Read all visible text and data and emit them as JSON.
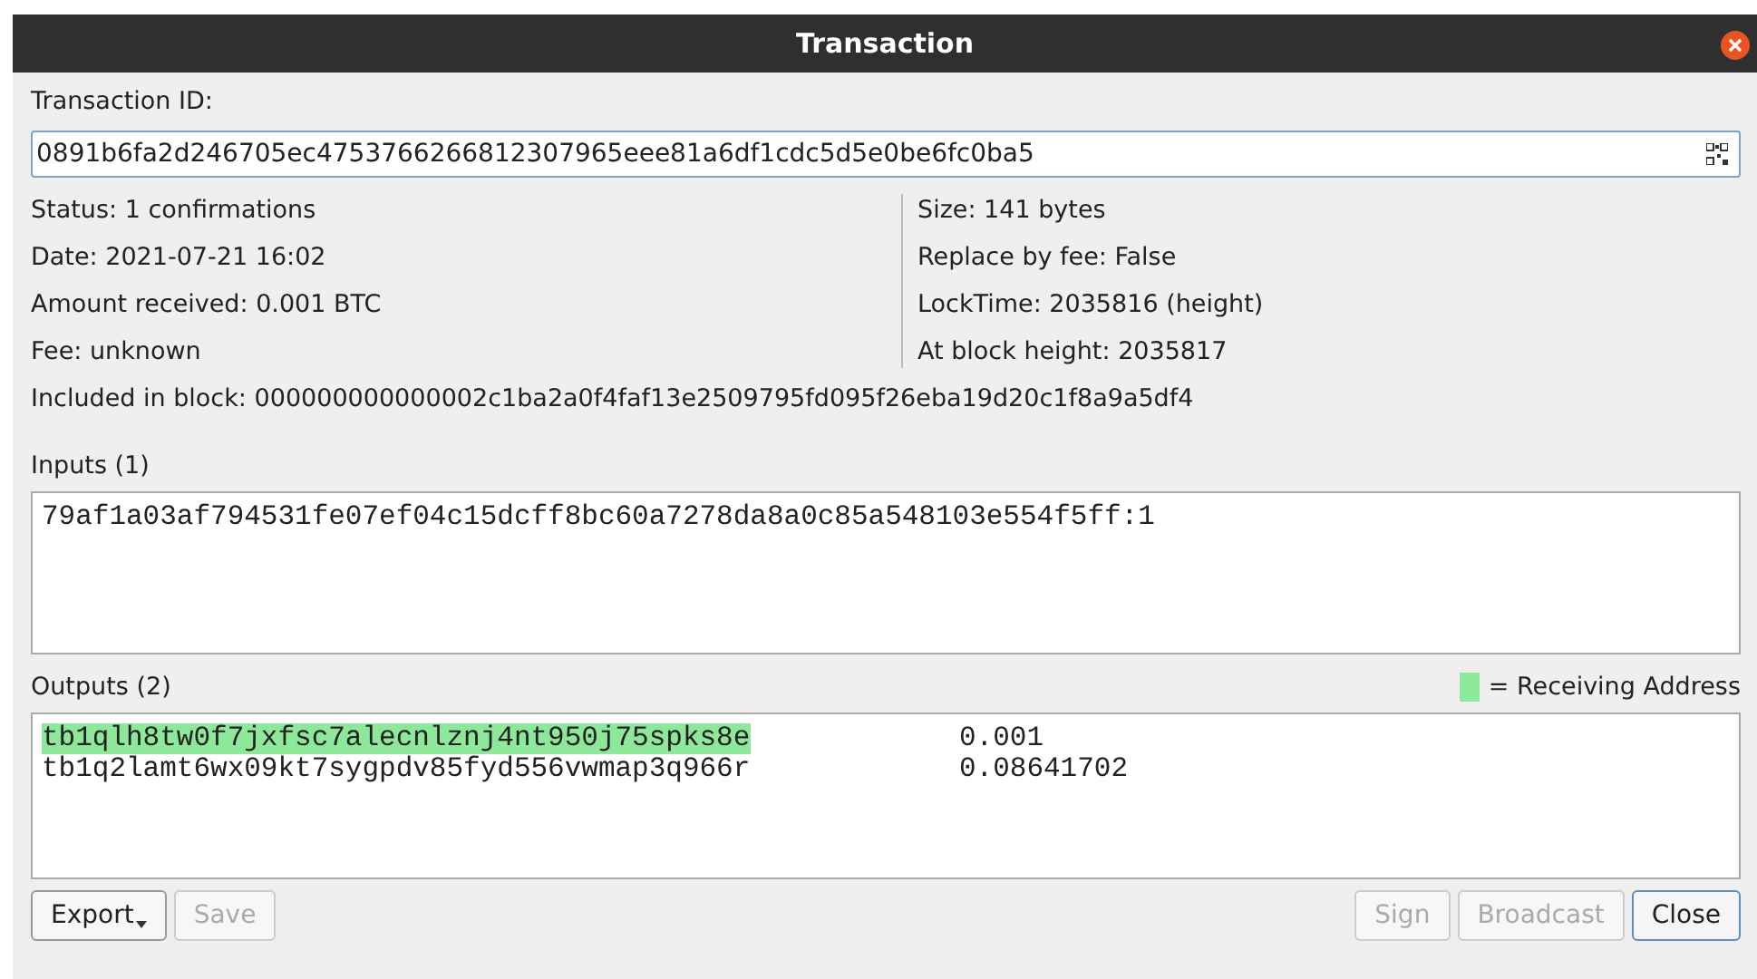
{
  "window": {
    "title": "Transaction"
  },
  "transaction_id": {
    "label": "Transaction ID:",
    "value": "0891b6fa2d246705ec4753766266812307965eee81a6df1cdc5d5e0be6fc0ba5"
  },
  "details_left": [
    "Status: 1 confirmations",
    "Date: 2021-07-21 16:02",
    "Amount received: 0.001 BTC",
    "Fee: unknown"
  ],
  "details_right": [
    "Size: 141 bytes",
    "Replace by fee: False",
    "LockTime: 2035816 (height)",
    "At block height: 2035817"
  ],
  "included_in_block": "Included in block: 000000000000002c1ba2a0f4faf13e2509795fd095f26eba19d20c1f8a9a5df4",
  "inputs": {
    "label": "Inputs (1)",
    "rows": [
      "79af1a03af794531fe07ef04c15dcff8bc60a7278da8a0c85a548103e554f5ff:1"
    ]
  },
  "outputs": {
    "label": "Outputs (2)",
    "legend": "= Receiving Address",
    "rows": [
      {
        "address": "tb1qlh8tw0f7jxfsc7alecnlznj4nt950j75spks8e",
        "amount": "0.001",
        "receiving": true
      },
      {
        "address": "tb1q2lamt6wx09kt7sygpdv85fyd556vwmap3q966r",
        "amount": "0.08641702",
        "receiving": false
      }
    ]
  },
  "buttons_left": [
    {
      "label": "Export",
      "menu": true,
      "disabled": false
    },
    {
      "label": "Save",
      "menu": false,
      "disabled": true
    }
  ],
  "buttons_right": [
    {
      "label": "Sign",
      "disabled": true,
      "default": false
    },
    {
      "label": "Broadcast",
      "disabled": true,
      "default": false
    },
    {
      "label": "Close",
      "disabled": false,
      "default": true
    }
  ]
}
